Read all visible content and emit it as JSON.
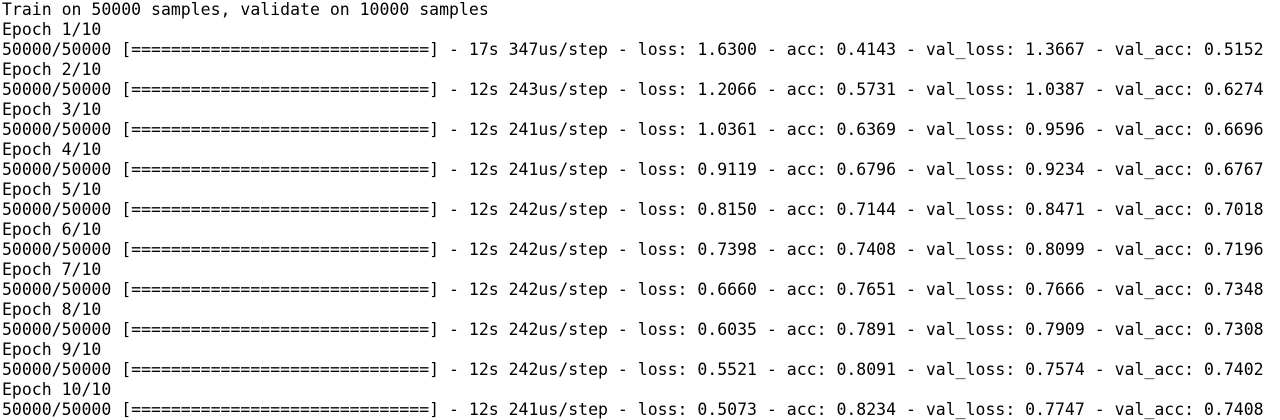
{
  "terminal": {
    "header": "Train on 50000 samples, validate on 10000 samples",
    "epochs": [
      {
        "epoch_label": "Epoch 1/10",
        "progress_line": "50000/50000 [==============================] - 17s 347us/step - loss: 1.6300 - acc: 0.4143 - val_loss: 1.3667 - val_acc: 0.5152"
      },
      {
        "epoch_label": "Epoch 2/10",
        "progress_line": "50000/50000 [==============================] - 12s 243us/step - loss: 1.2066 - acc: 0.5731 - val_loss: 1.0387 - val_acc: 0.6274"
      },
      {
        "epoch_label": "Epoch 3/10",
        "progress_line": "50000/50000 [==============================] - 12s 241us/step - loss: 1.0361 - acc: 0.6369 - val_loss: 0.9596 - val_acc: 0.6696"
      },
      {
        "epoch_label": "Epoch 4/10",
        "progress_line": "50000/50000 [==============================] - 12s 241us/step - loss: 0.9119 - acc: 0.6796 - val_loss: 0.9234 - val_acc: 0.6767"
      },
      {
        "epoch_label": "Epoch 5/10",
        "progress_line": "50000/50000 [==============================] - 12s 242us/step - loss: 0.8150 - acc: 0.7144 - val_loss: 0.8471 - val_acc: 0.7018"
      },
      {
        "epoch_label": "Epoch 6/10",
        "progress_line": "50000/50000 [==============================] - 12s 242us/step - loss: 0.7398 - acc: 0.7408 - val_loss: 0.8099 - val_acc: 0.7196"
      },
      {
        "epoch_label": "Epoch 7/10",
        "progress_line": "50000/50000 [==============================] - 12s 242us/step - loss: 0.6660 - acc: 0.7651 - val_loss: 0.7666 - val_acc: 0.7348"
      },
      {
        "epoch_label": "Epoch 8/10",
        "progress_line": "50000/50000 [==============================] - 12s 242us/step - loss: 0.6035 - acc: 0.7891 - val_loss: 0.7909 - val_acc: 0.7308"
      },
      {
        "epoch_label": "Epoch 9/10",
        "progress_line": "50000/50000 [==============================] - 12s 242us/step - loss: 0.5521 - acc: 0.8091 - val_loss: 0.7574 - val_acc: 0.7402"
      },
      {
        "epoch_label": "Epoch 10/10",
        "progress_line": "50000/50000 [==============================] - 12s 241us/step - loss: 0.5073 - acc: 0.8234 - val_loss: 0.7747 - val_acc: 0.7408"
      }
    ]
  }
}
